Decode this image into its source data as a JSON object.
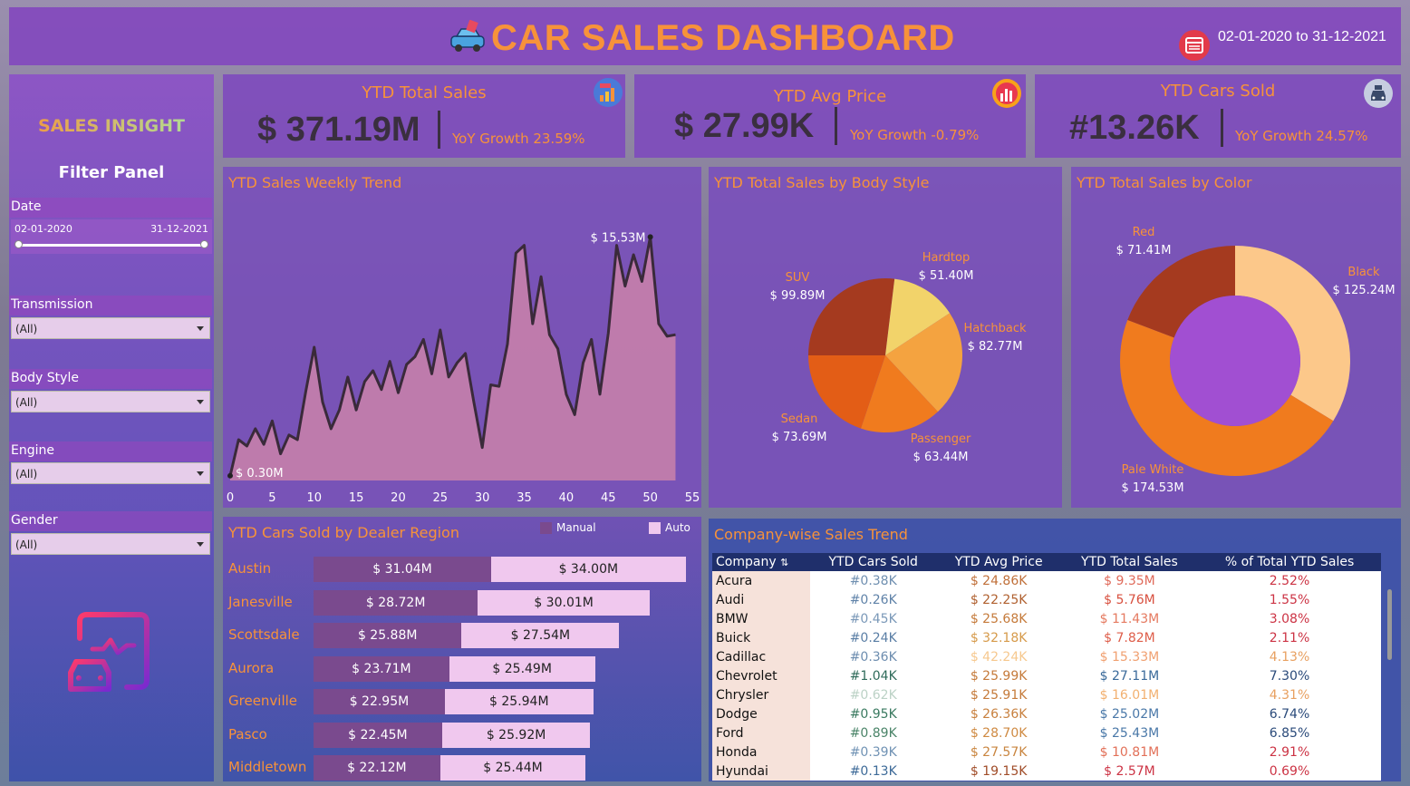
{
  "header": {
    "title": "CAR SALES DASHBOARD",
    "date_range": "02-01-2020 to 31-12-2021"
  },
  "sidebar": {
    "insight_title": "SALES INSIGHT",
    "filter_title": "Filter Panel",
    "date": {
      "label": "Date",
      "start": "02-01-2020",
      "end": "31-12-2021"
    },
    "filters": [
      {
        "label": "Transmission",
        "value": "(All)"
      },
      {
        "label": "Body Style",
        "value": "(All)"
      },
      {
        "label": "Engine",
        "value": "(All)"
      },
      {
        "label": "Gender",
        "value": "(All)"
      }
    ]
  },
  "kpis": [
    {
      "title": "YTD Total Sales",
      "value": "$ 371.19M",
      "growth": "YoY Growth 23.59%",
      "icon": "sales-chart-icon"
    },
    {
      "title": "YTD Avg Price",
      "value": "$ 27.99K",
      "growth": "YoY Growth -0.79%",
      "icon": "bar-chart-icon"
    },
    {
      "title": "YTD Cars Sold",
      "value": "#13.26K",
      "growth": "YoY Growth 24.57%",
      "icon": "car-icon"
    }
  ],
  "weekly_trend": {
    "title": "YTD Sales Weekly Trend",
    "max_label": "$ 15.53M",
    "min_label": "$ 0.30M",
    "chart_data": {
      "type": "area",
      "x": [
        0,
        1,
        2,
        3,
        4,
        5,
        6,
        7,
        8,
        9,
        10,
        11,
        12,
        13,
        14,
        15,
        16,
        17,
        18,
        19,
        20,
        21,
        22,
        23,
        24,
        25,
        26,
        27,
        28,
        29,
        30,
        31,
        32,
        33,
        34,
        35,
        36,
        37,
        38,
        39,
        40,
        41,
        42,
        43,
        44,
        45,
        46,
        47,
        48,
        49,
        50,
        51,
        52,
        53
      ],
      "values": [
        0.3,
        2.6,
        2.2,
        3.3,
        2.3,
        3.8,
        1.7,
        2.9,
        2.6,
        5.7,
        8.5,
        5.0,
        3.3,
        4.5,
        6.6,
        4.5,
        6.3,
        7.0,
        5.8,
        7.6,
        5.6,
        7.4,
        7.9,
        9.0,
        6.8,
        9.6,
        6.6,
        7.5,
        8.1,
        5.0,
        2.1,
        6.1,
        6.0,
        8.7,
        14.5,
        15.0,
        10.0,
        13.0,
        9.3,
        8.4,
        5.5,
        4.2,
        7.5,
        9.0,
        5.5,
        9.4,
        15.0,
        12.4,
        14.4,
        12.7,
        15.53,
        10.0,
        9.2,
        9.3
      ],
      "xlim": [
        0,
        55
      ],
      "x_ticks": [
        "0",
        "5",
        "10",
        "15",
        "20",
        "25",
        "30",
        "35",
        "40",
        "45",
        "50",
        "55"
      ],
      "ylim": [
        0,
        17
      ]
    }
  },
  "body_style": {
    "title": "YTD Total Sales by Body Style",
    "chart_data": {
      "type": "pie",
      "categories": [
        "SUV",
        "Hardtop",
        "Hatchback",
        "Passenger",
        "Sedan"
      ],
      "values": [
        99.89,
        51.4,
        82.77,
        63.44,
        73.69
      ],
      "labels": [
        "$ 99.89M",
        "$ 51.40M",
        "$ 82.77M",
        "$ 63.44M",
        "$ 73.69M"
      ],
      "colors": [
        "#a53a1f",
        "#f2d36a",
        "#f4a340",
        "#f07b1e",
        "#e35d16"
      ]
    }
  },
  "color_sales": {
    "title": "YTD Total Sales by Color",
    "chart_data": {
      "type": "pie",
      "categories": [
        "Red",
        "Black",
        "Pale White"
      ],
      "values": [
        71.41,
        125.24,
        174.53
      ],
      "labels": [
        "$ 71.41M",
        "$ 125.24M",
        "$ 174.53M"
      ],
      "colors": [
        "#a53a1f",
        "#fcc88a",
        "#f07b1e"
      ],
      "center_color": "#a14fd2"
    }
  },
  "dealer_region": {
    "title": "YTD Cars Sold by Dealer Region",
    "legend": {
      "manual": "Manual",
      "auto": "Auto"
    },
    "colors": {
      "manual": "#7a4a8e",
      "auto": "#f0c8ee"
    },
    "chart_data": {
      "type": "bar",
      "categories": [
        "Austin",
        "Janesville",
        "Scottsdale",
        "Aurora",
        "Greenville",
        "Pasco",
        "Middletown"
      ],
      "series": [
        {
          "name": "Manual",
          "values": [
            31.04,
            28.72,
            25.88,
            23.71,
            22.95,
            22.45,
            22.12
          ],
          "labels": [
            "$ 31.04M",
            "$ 28.72M",
            "$ 25.88M",
            "$ 23.71M",
            "$ 22.95M",
            "$ 22.45M",
            "$ 22.12M"
          ]
        },
        {
          "name": "Auto",
          "values": [
            34.0,
            30.01,
            27.54,
            25.49,
            25.94,
            25.92,
            25.44
          ],
          "labels": [
            "$ 34.00M",
            "$ 30.01M",
            "$ 27.54M",
            "$ 25.49M",
            "$ 25.94M",
            "$ 25.92M",
            "$ 25.44M"
          ]
        }
      ]
    }
  },
  "company_table": {
    "title": "Company-wise Sales Trend",
    "columns": [
      "Company",
      "YTD Cars Sold",
      "YTD Avg Price",
      "YTD Total Sales",
      "% of Total YTD Sales"
    ],
    "rows": [
      {
        "company": "Acura",
        "sold": "#0.38K",
        "avg": "$ 24.86K",
        "total": "$ 9.35M",
        "pct": "2.52%",
        "c_sold": "#6f8fb0",
        "c_avg": "#c0703a",
        "c_total": "#e06a5a",
        "c_pct": "#cc3344"
      },
      {
        "company": "Audi",
        "sold": "#0.26K",
        "avg": "$ 22.25K",
        "total": "$ 5.76M",
        "pct": "1.55%",
        "c_sold": "#5f82a8",
        "c_avg": "#b0602f",
        "c_total": "#d8503f",
        "c_pct": "#cc3344"
      },
      {
        "company": "BMW",
        "sold": "#0.45K",
        "avg": "$ 25.68K",
        "total": "$ 11.43M",
        "pct": "3.08%",
        "c_sold": "#7a98b8",
        "c_avg": "#c57a3a",
        "c_total": "#e57a60",
        "c_pct": "#cc3344"
      },
      {
        "company": "Buick",
        "sold": "#0.24K",
        "avg": "$ 32.18K",
        "total": "$ 7.82M",
        "pct": "2.11%",
        "c_sold": "#5a7ea5",
        "c_avg": "#d69a4a",
        "c_total": "#de5e4a",
        "c_pct": "#cc3344"
      },
      {
        "company": "Cadillac",
        "sold": "#0.36K",
        "avg": "$ 42.24K",
        "total": "$ 15.33M",
        "pct": "4.13%",
        "c_sold": "#6d8daf",
        "c_avg": "#f6c88e",
        "c_total": "#f0a070",
        "c_pct": "#e8a060"
      },
      {
        "company": "Chevrolet",
        "sold": "#1.04K",
        "avg": "$ 25.99K",
        "total": "$ 27.11M",
        "pct": "7.30%",
        "c_sold": "#2f6b5a",
        "c_avg": "#c57a3a",
        "c_total": "#3a6a9a",
        "c_pct": "#2a4a7a"
      },
      {
        "company": "Chrysler",
        "sold": "#0.62K",
        "avg": "$ 25.91K",
        "total": "$ 16.01M",
        "pct": "4.31%",
        "c_sold": "#bcd2c6",
        "c_avg": "#c57a3a",
        "c_total": "#f2b070",
        "c_pct": "#e8a060"
      },
      {
        "company": "Dodge",
        "sold": "#0.95K",
        "avg": "$ 26.36K",
        "total": "$ 25.02M",
        "pct": "6.74%",
        "c_sold": "#3a7a60",
        "c_avg": "#c8803e",
        "c_total": "#4a78a8",
        "c_pct": "#2a4a7a"
      },
      {
        "company": "Ford",
        "sold": "#0.89K",
        "avg": "$ 28.70K",
        "total": "$ 25.43M",
        "pct": "6.85%",
        "c_sold": "#4a8468",
        "c_avg": "#cf8a42",
        "c_total": "#4a78a8",
        "c_pct": "#2a4a7a"
      },
      {
        "company": "Honda",
        "sold": "#0.39K",
        "avg": "$ 27.57K",
        "total": "$ 10.81M",
        "pct": "2.91%",
        "c_sold": "#7092b4",
        "c_avg": "#c9853f",
        "c_total": "#e27058",
        "c_pct": "#cc3344"
      },
      {
        "company": "Hyundai",
        "sold": "#0.13K",
        "avg": "$ 19.15K",
        "total": "$ 2.57M",
        "pct": "0.69%",
        "c_sold": "#3d6a98",
        "c_avg": "#a04c28",
        "c_total": "#cc3344",
        "c_pct": "#cc3344"
      }
    ]
  }
}
